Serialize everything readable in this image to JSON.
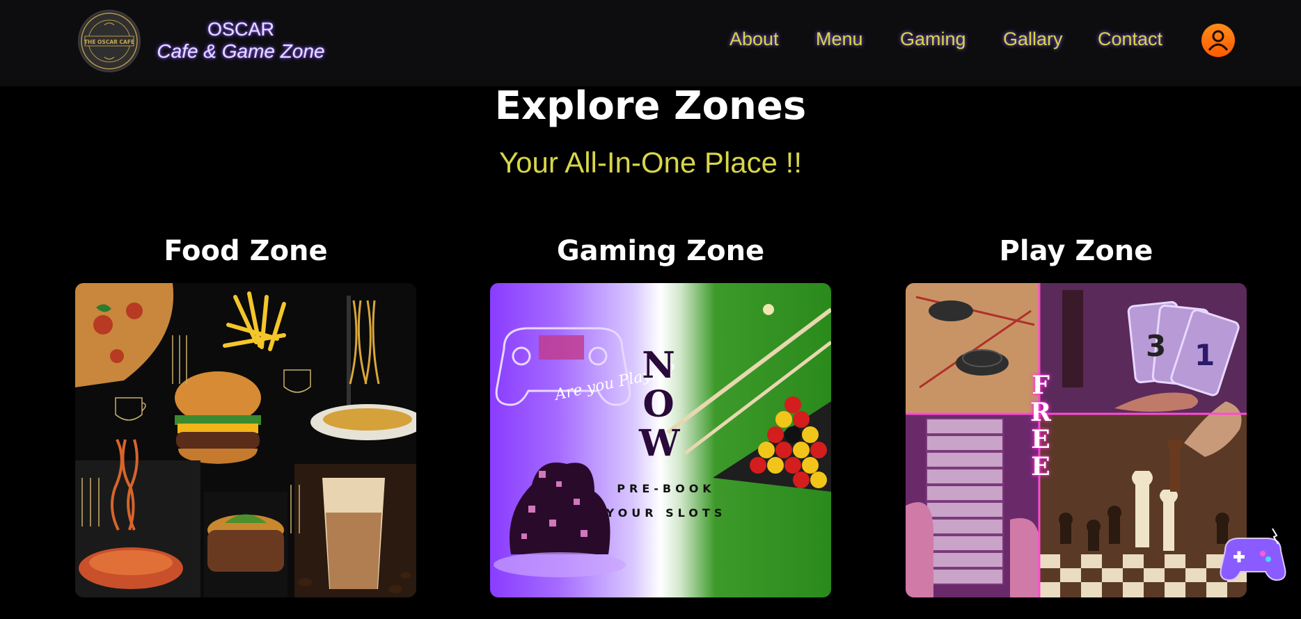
{
  "brand": {
    "line1": "OSCAR",
    "line2": "Cafe & Game Zone",
    "logo_text": "THE OSCAR CAFE"
  },
  "nav": {
    "links": [
      "About",
      "Menu",
      "Gaming",
      "Gallary",
      "Contact"
    ],
    "avatar_icon": "user-icon"
  },
  "hero": {
    "title": "Explore Zones",
    "subtitle": "Your All-In-One Place !!"
  },
  "zones": [
    {
      "title": "Food Zone"
    },
    {
      "title": "Gaming Zone",
      "overlay": {
        "now_letters": [
          "N",
          "O",
          "W"
        ],
        "line1": "PRE-BOOK",
        "line2": "YOUR SLOTS",
        "controller_text": "Are you Player?"
      }
    },
    {
      "title": "Play Zone",
      "overlay": {
        "free_letters": [
          "F",
          "R",
          "E",
          "E"
        ]
      }
    }
  ],
  "colors": {
    "accent_yellow": "#d7d64a",
    "glow_purple": "#9b6bff",
    "avatar_orange": "#ff7a0a",
    "background": "#000000"
  }
}
